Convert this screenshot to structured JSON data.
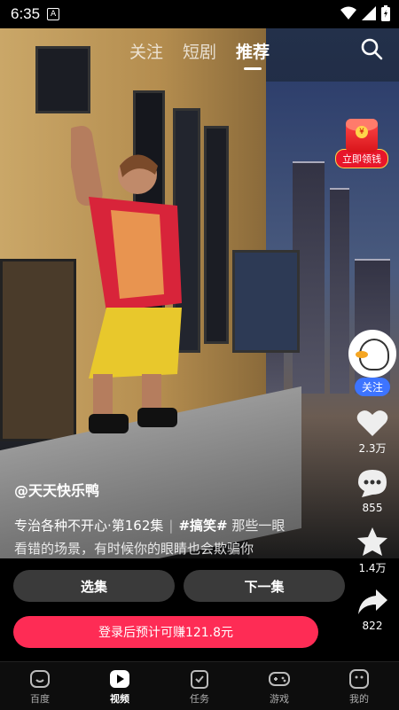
{
  "status_bar": {
    "time": "6:35",
    "notification": "A"
  },
  "top_nav": {
    "tabs": [
      "关注",
      "短剧",
      "推荐"
    ],
    "active": "推荐"
  },
  "watermark": "天天快乐鸭",
  "red_envelope": {
    "label": "立即领钱",
    "symbol": "¥"
  },
  "creator": {
    "follow_label": "关注"
  },
  "actions": {
    "likes": "2.3万",
    "comments": "855",
    "favorites": "1.4万",
    "shares": "822"
  },
  "video_info": {
    "author": "@天天快乐鸭",
    "title": "专治各种不开心·第162集",
    "separator": "|",
    "tags": "#搞笑#",
    "desc_line1_tail": "那些一眼",
    "desc_line2": "看错的场景，有时候你的眼睛也会欺骗你"
  },
  "buttons": {
    "episodes": "选集",
    "next": "下一集",
    "earn": "登录后预计可赚121.8元"
  },
  "tab_bar": {
    "items": [
      "百度",
      "视频",
      "任务",
      "游戏",
      "我的"
    ],
    "active": "视频"
  },
  "colors": {
    "accent": "#fe2c55",
    "follow": "#3d74ff",
    "red_envelope": "#e8162a"
  }
}
